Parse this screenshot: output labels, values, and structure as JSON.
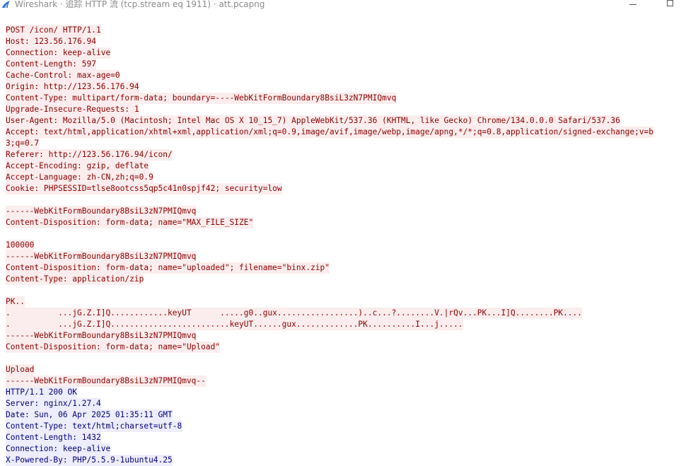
{
  "window": {
    "title": "Wireshark · 追踪 HTTP 流 (tcp.stream eq 1911) · att.pcapng"
  },
  "stream": {
    "request_lines": [
      "POST /icon/ HTTP/1.1",
      "Host: 123.56.176.94",
      "Connection: keep-alive",
      "Content-Length: 597",
      "Cache-Control: max-age=0",
      "Origin: http://123.56.176.94",
      "Content-Type: multipart/form-data; boundary=----WebKitFormBoundary8BsiL3zN7PMIQmvq",
      "Upgrade-Insecure-Requests: 1",
      "User-Agent: Mozilla/5.0 (Macintosh; Intel Mac OS X 10_15_7) AppleWebKit/537.36 (KHTML, like Gecko) Chrome/134.0.0.0 Safari/537.36",
      "Accept: text/html,application/xhtml+xml,application/xml;q=0.9,image/avif,image/webp,image/apng,*/*;q=0.8,application/signed-exchange;v=b",
      "3;q=0.7",
      "Referer: http://123.56.176.94/icon/",
      "Accept-Encoding: gzip, deflate",
      "Accept-Language: zh-CN,zh;q=0.9",
      "Cookie: PHPSESSID=tlse8ootcss5qp5c41n0spjf42; security=low",
      "",
      "------WebKitFormBoundary8BsiL3zN7PMIQmvq",
      "Content-Disposition: form-data; name=\"MAX_FILE_SIZE\"",
      "",
      "100000",
      "------WebKitFormBoundary8BsiL3zN7PMIQmvq",
      "Content-Disposition: form-data; name=\"uploaded\"; filename=\"binx.zip\"",
      "Content-Type: application/zip",
      "",
      "PK..",
      ".          ...jG.Z.I]Q............keyUT      .....g0..gux.................)..c...?........V.|rQv...PK...I]Q........PK....",
      ".          ...jG.Z.I]Q.........................keyUT......gux.............PK..........I...j.....",
      "------WebKitFormBoundary8BsiL3zN7PMIQmvq",
      "Content-Disposition: form-data; name=\"Upload\"",
      "",
      "Upload",
      "------WebKitFormBoundary8BsiL3zN7PMIQmvq--"
    ],
    "response_lines": [
      "HTTP/1.1 200 OK",
      "Server: nginx/1.27.4",
      "Date: Sun, 06 Apr 2025 01:35:11 GMT",
      "Content-Type: text/html;charset=utf-8",
      "Content-Length: 1432",
      "Connection: keep-alive",
      "X-Powered-By: PHP/5.5.9-1ubuntu4.25"
    ]
  },
  "colors": {
    "request_text": "#8b0000",
    "request_bg": "#fbeded",
    "response_text": "#00007a",
    "response_bg": "#ededfb",
    "title_text": "#8a8a8a",
    "app_icon": "#1f6bd6"
  },
  "icons": {
    "app": "wireshark-fin-icon",
    "minimize": "minimize-icon",
    "maximize": "maximize-icon"
  }
}
